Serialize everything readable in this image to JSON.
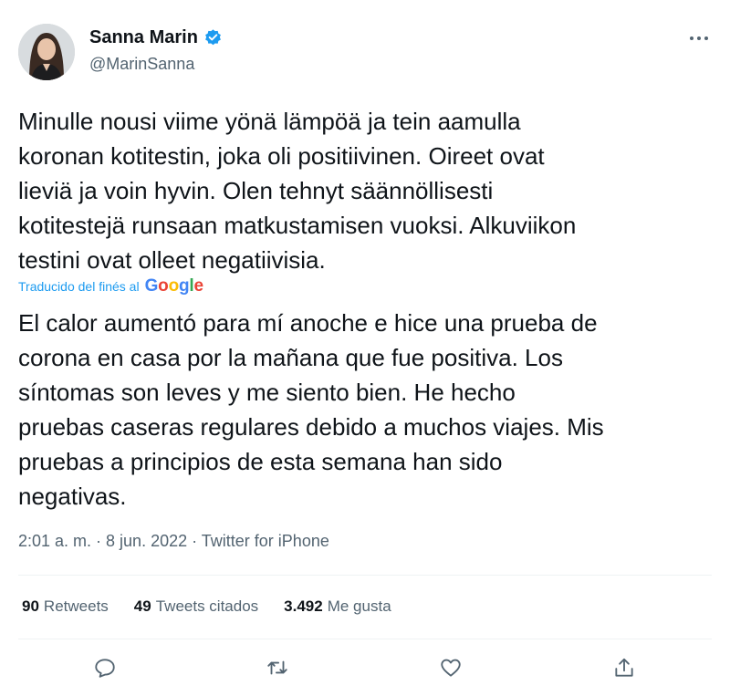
{
  "author": {
    "name": "Sanna Marin",
    "handle": "@MarinSanna",
    "verified": true,
    "avatar_icon": "profile-photo"
  },
  "more_icon": "more-horizontal-icon",
  "tweet": {
    "original_text": "Minulle nousi viime yönä lämpöä ja tein aamulla\nkoronan kotitestin, joka oli positiivinen. Oireet ovat\nlieviä ja voin hyvin. Olen tehnyt säännöllisesti\nkotitestejä runsaan matkustamisen vuoksi. Alkuviikon\ntestini ovat olleet negatiivisia.",
    "translated_label": "Traducido del finés al",
    "translator_brand": "Google",
    "translated_text": "El calor aumentó para mí anoche e hice una prueba de\ncorona en casa por la mañana que fue positiva. Los\nsíntomas son leves y me siento bien. He hecho\npruebas caseras regulares debido a muchos viajes. Mis\npruebas a principios de esta semana han sido\nnegativas.",
    "meta": "2:01 a. m. · 8 jun. 2022 · Twitter for iPhone"
  },
  "stats": {
    "retweets_count": "90",
    "retweets_label": "Retweets",
    "quotes_count": "49",
    "quotes_label": "Tweets citados",
    "likes_count": "3.492",
    "likes_label": "Me gusta"
  },
  "actions": {
    "reply_icon": "reply-icon",
    "retweet_icon": "retweet-icon",
    "like_icon": "like-icon",
    "share_icon": "share-icon"
  },
  "colors": {
    "link": "#1d9bf0",
    "text": "#0f1419",
    "secondary": "#536471",
    "divider": "#eff3f4"
  }
}
